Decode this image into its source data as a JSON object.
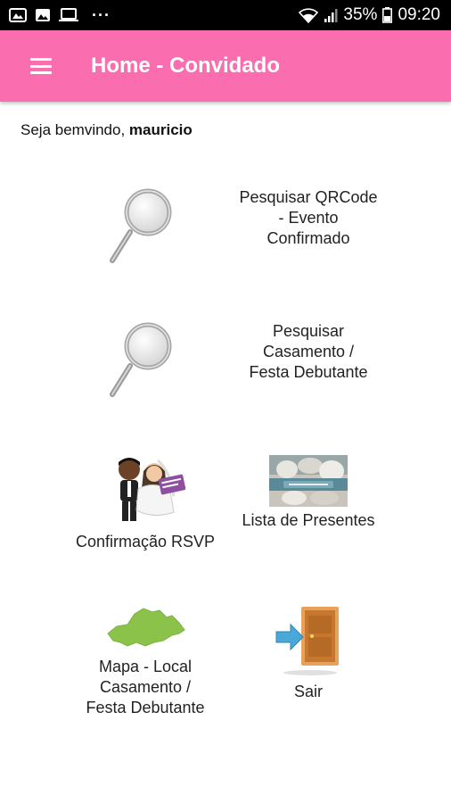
{
  "status_bar": {
    "battery": "35%",
    "time": "09:20",
    "more": "···"
  },
  "app_bar": {
    "title": "Home - Convidado"
  },
  "welcome": {
    "prefix": "Seja bemvindo,",
    "user": "mauricio"
  },
  "tiles": [
    {
      "label": "Pesquisar QRCode\n- Evento\nConfirmado",
      "icon": "magnifier-icon"
    },
    {
      "label": "Pesquisar\nCasamento /\nFesta Debutante",
      "icon": "magnifier-icon"
    },
    {
      "label": "Confirmação RSVP",
      "icon": "couple-icon"
    },
    {
      "label": "Lista de Presentes",
      "icon": "gift-list-photo"
    },
    {
      "label": "Mapa - Local\nCasamento /\nFesta Debutante",
      "icon": "map-icon"
    },
    {
      "label": "Sair",
      "icon": "exit-door-icon"
    }
  ],
  "colors": {
    "app_bar": "#fa6eaf",
    "status_bar": "#000000",
    "map_green": "#8bc34a",
    "door": "#c8782e",
    "arrow": "#4aa8d8"
  }
}
